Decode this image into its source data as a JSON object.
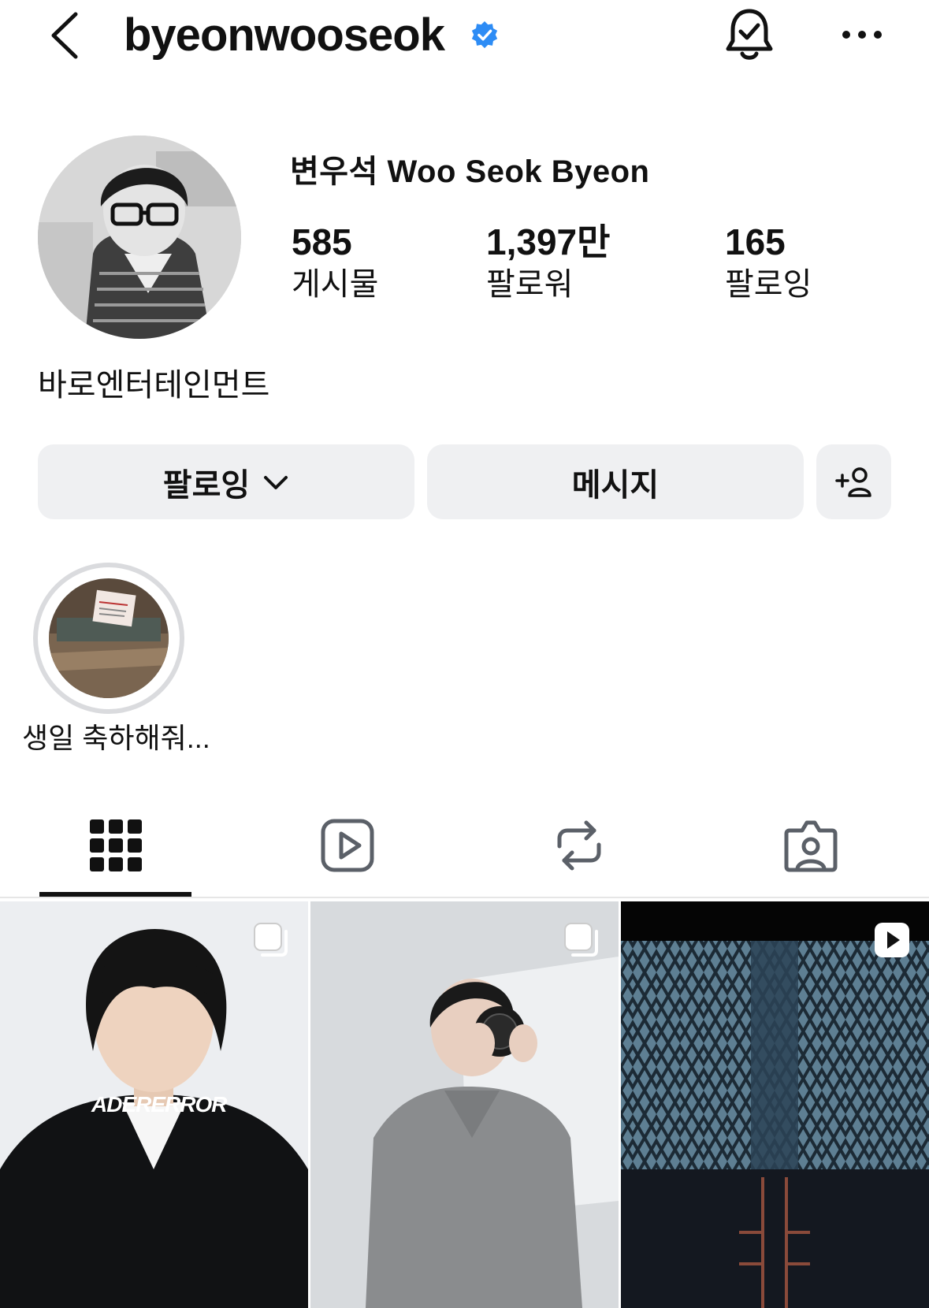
{
  "header": {
    "username": "byeonwooseok",
    "verified_icon": "verified-badge-icon",
    "notification_icon": "bell-check-icon",
    "more_icon": "more-dots-icon"
  },
  "profile": {
    "display_name": "변우석  Woo Seok Byeon",
    "stats": [
      {
        "value": "585",
        "label": "게시물"
      },
      {
        "value": "1,397만",
        "label": "팔로워"
      },
      {
        "value": "165",
        "label": "팔로잉"
      }
    ],
    "bio": "바로엔터테인먼트"
  },
  "actions": {
    "following_label": "팔로잉",
    "message_label": "메시지",
    "add_icon": "add-person-icon"
  },
  "highlights": [
    {
      "label": "생일 축하해줘..."
    }
  ],
  "tabs": [
    {
      "icon": "grid-icon",
      "active": true
    },
    {
      "icon": "reels-icon",
      "active": false
    },
    {
      "icon": "repost-icon",
      "active": false
    },
    {
      "icon": "tagged-icon",
      "active": false
    }
  ],
  "posts": [
    {
      "type": "carousel",
      "overlay_text": "ADERERROR"
    },
    {
      "type": "carousel"
    },
    {
      "type": "reel"
    }
  ],
  "colors": {
    "verified": "#2d8cf5",
    "button_bg": "#eff0f2",
    "text": "#111111"
  }
}
